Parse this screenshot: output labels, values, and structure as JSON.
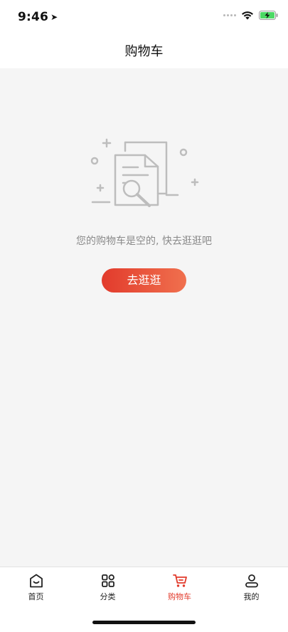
{
  "status": {
    "time": "9:46"
  },
  "nav": {
    "title": "购物车"
  },
  "empty": {
    "message": "您的购物车是空的, 快去逛逛吧",
    "button_label": "去逛逛"
  },
  "tabbar": {
    "items": [
      {
        "label": "首页",
        "icon": "home-icon"
      },
      {
        "label": "分类",
        "icon": "grid-icon"
      },
      {
        "label": "购物车",
        "icon": "cart-icon",
        "active": true
      },
      {
        "label": "我的",
        "icon": "user-icon"
      }
    ]
  },
  "colors": {
    "accent": "#e23b2c",
    "accent_gradient_end": "#f0704e",
    "page_bg": "#f5f5f5"
  }
}
